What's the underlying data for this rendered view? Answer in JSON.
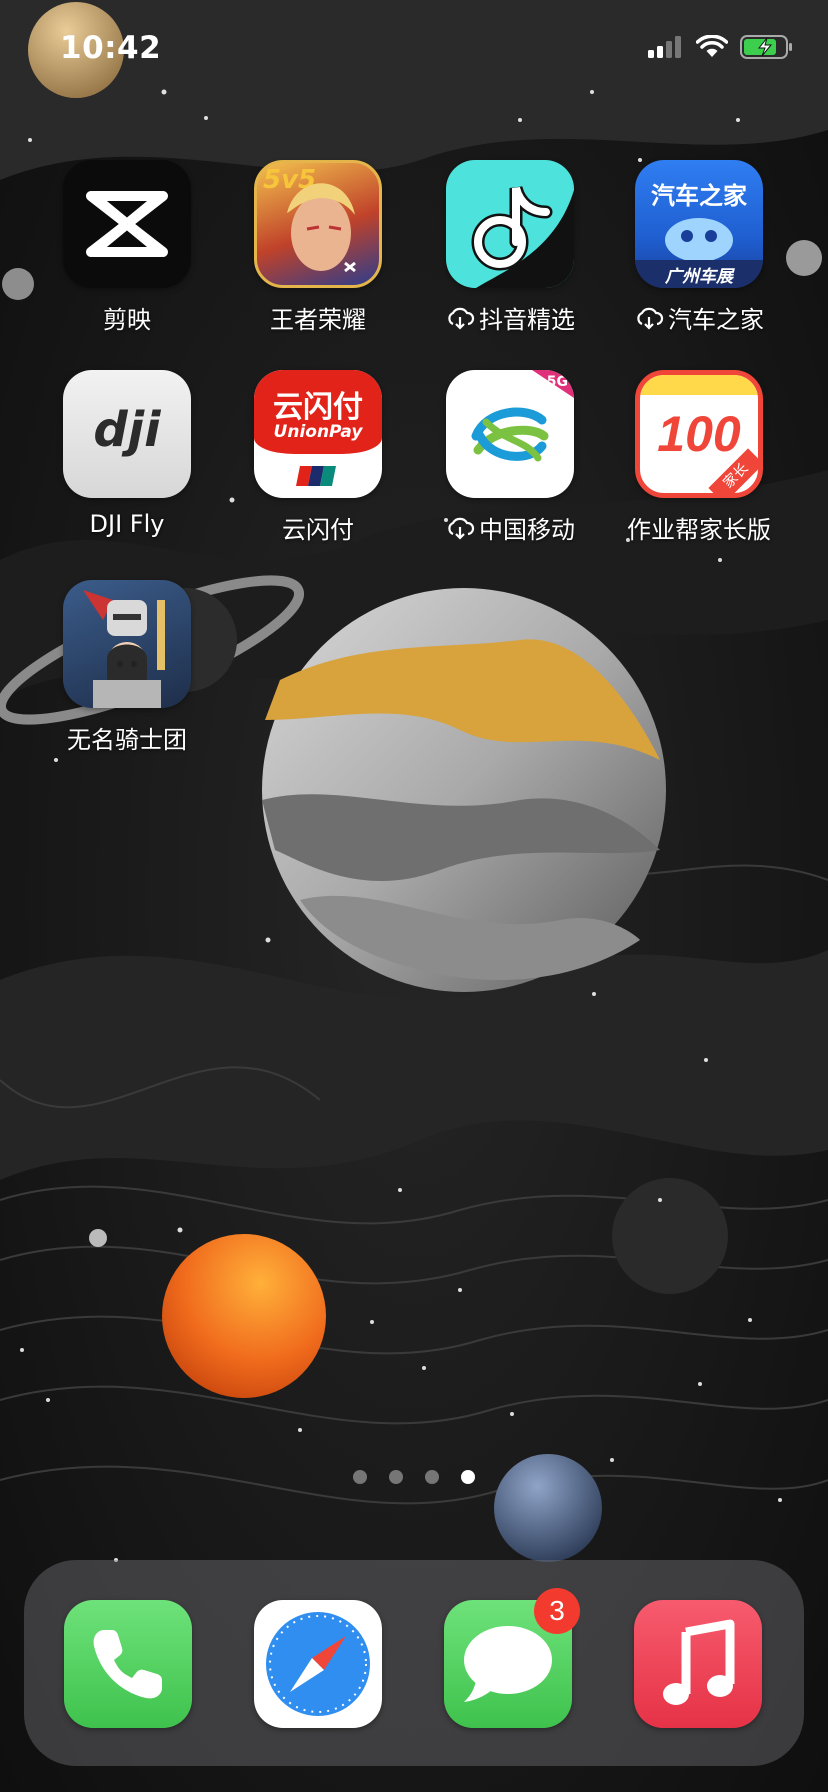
{
  "status_bar": {
    "time": "10:42"
  },
  "home": {
    "apps": [
      {
        "label": "剪映",
        "icon": "capcut-icon",
        "cloud": false
      },
      {
        "label": "王者荣耀",
        "icon": "honor-of-kings-icon",
        "cloud": false,
        "icon_text": "5v5"
      },
      {
        "label": "抖音精选",
        "icon": "douyin-icon",
        "cloud": true
      },
      {
        "label": "汽车之家",
        "icon": "autohome-icon",
        "cloud": true,
        "icon_text": "汽车之家",
        "icon_subtext": "广州车展"
      },
      {
        "label": "DJI Fly",
        "icon": "dji-icon",
        "cloud": false,
        "icon_text": "dji"
      },
      {
        "label": "云闪付",
        "icon": "unionpay-icon",
        "cloud": false,
        "icon_text": "云闪付",
        "icon_subtext": "UnionPay"
      },
      {
        "label": "中国移动",
        "icon": "china-mobile-icon",
        "cloud": true,
        "icon_text": "5G"
      },
      {
        "label": "作业帮家长版",
        "icon": "zuoyebang-icon",
        "cloud": false,
        "icon_text": "100",
        "icon_subtext": "家长"
      },
      {
        "label": "无名骑士团",
        "icon": "knight-game-icon",
        "cloud": false
      }
    ]
  },
  "page_indicator": {
    "count": 4,
    "active": 4
  },
  "dock": {
    "apps": [
      {
        "name": "Phone",
        "icon": "phone-icon"
      },
      {
        "name": "Safari",
        "icon": "safari-icon"
      },
      {
        "name": "Messages",
        "icon": "messages-icon",
        "badge": "3"
      },
      {
        "name": "Music",
        "icon": "music-icon"
      }
    ]
  },
  "colors": {
    "badge": "#f23b2e",
    "douyin_bg": "#4de3dc",
    "unionpay_red": "#e2231a",
    "phone_green": "#5ed466",
    "music_red": "#f0475b"
  }
}
